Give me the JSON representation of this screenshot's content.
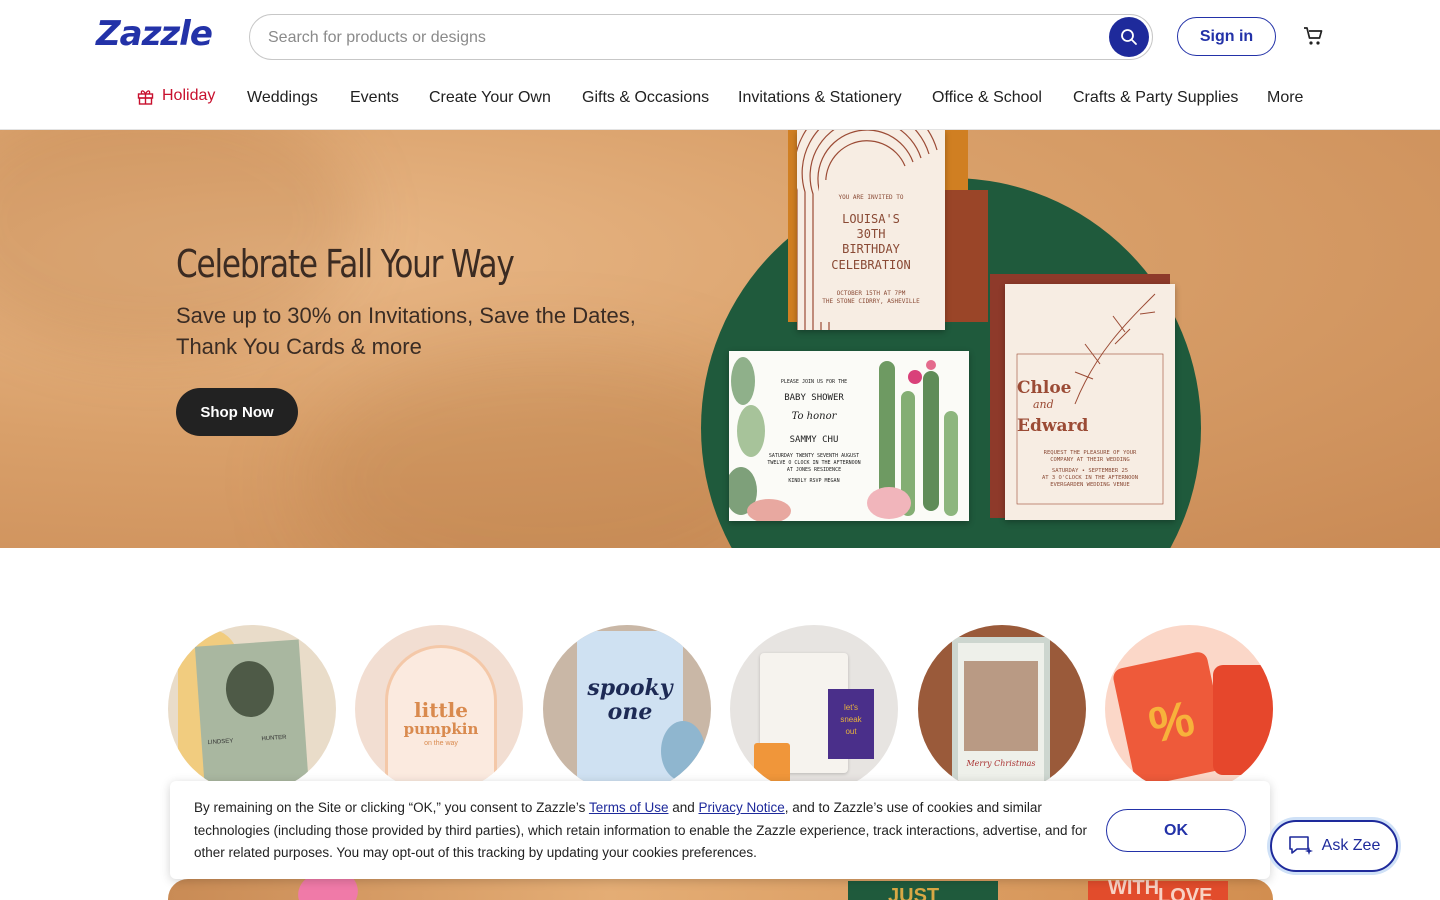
{
  "header": {
    "logo": "Zazzle",
    "search_placeholder": "Search for products or designs",
    "signin_label": "Sign in",
    "brand_color": "#2332a8"
  },
  "nav": {
    "items": [
      {
        "label": "Holiday",
        "icon": "gift-icon",
        "color": "#c8102e"
      },
      {
        "label": "Weddings"
      },
      {
        "label": "Events"
      },
      {
        "label": "Create Your Own"
      },
      {
        "label": "Gifts & Occasions"
      },
      {
        "label": "Invitations & Stationery"
      },
      {
        "label": "Office & School"
      },
      {
        "label": "Crafts & Party Supplies"
      },
      {
        "label": "More"
      }
    ]
  },
  "hero": {
    "title": "Celebrate Fall Your Way",
    "subtitle": "Save up to 30% on Invitations, Save the Dates, Thank You Cards & more",
    "button_label": "Shop Now",
    "cards": {
      "birthday": [
        "YOU ARE INVITED TO",
        "LOUISA'S",
        "30TH",
        "BIRTHDAY",
        "CELEBRATION",
        "OCTOBER 15TH AT 7PM",
        "THE STONE CIDRRY, ASHEVILLE"
      ],
      "baby_shower": [
        "PLEASE JOIN US FOR THE",
        "BABY SHOWER",
        "To honor",
        "SAMMY CHU",
        "SATURDAY TWENTY SEVENTH AUGUST",
        "TWELVE O CLOCK IN THE AFTERNOON",
        "AT JONES RESIDENCE",
        "KINDLY RSVP MEGAN"
      ],
      "wedding": [
        "Chloe",
        "and",
        "Edward",
        "REQUEST THE PLEASURE OF YOUR",
        "COMPANY AT THEIR WEDDING",
        "SATURDAY • SEPTEMBER 25",
        "AT 3 O'CLOCK IN THE AFTERNOON",
        "EVERGARDEN WEDDING VENUE"
      ]
    }
  },
  "categories": [
    {
      "name": "wedding-invitation-category",
      "texts": [
        "LINDSEY",
        "HUNTER"
      ]
    },
    {
      "name": "baby-shower-category",
      "texts": [
        "little",
        "pumpkin",
        "on the way"
      ]
    },
    {
      "name": "halloween-birthday-category",
      "texts": [
        "spooky",
        "one"
      ]
    },
    {
      "name": "tote-bag-category",
      "texts": [
        "let's",
        "sneak",
        "out"
      ]
    },
    {
      "name": "christmas-card-category",
      "texts": [
        "Merry Christmas"
      ]
    },
    {
      "name": "sale-category",
      "texts": [
        "%"
      ]
    }
  ],
  "cookie": {
    "text_before": "By remaining on the Site or clicking “OK,” you consent to Zazzle’s ",
    "terms_link": "Terms of Use",
    "and_text": " and ",
    "privacy_link": "Privacy Notice",
    "text_after": ", and to Zazzle’s use of cookies and similar technologies (including those provided by third parties), which retain information to enable the Zazzle experience, track interactions, advertise, and for other related purposes. You may opt-out of this tracking by updating your cookies preferences.",
    "ok_label": "OK"
  },
  "ask_zee": {
    "label": "Ask Zee"
  },
  "bottom_strip": {
    "texts": [
      "JUST",
      "WITH",
      "LOVE"
    ]
  }
}
